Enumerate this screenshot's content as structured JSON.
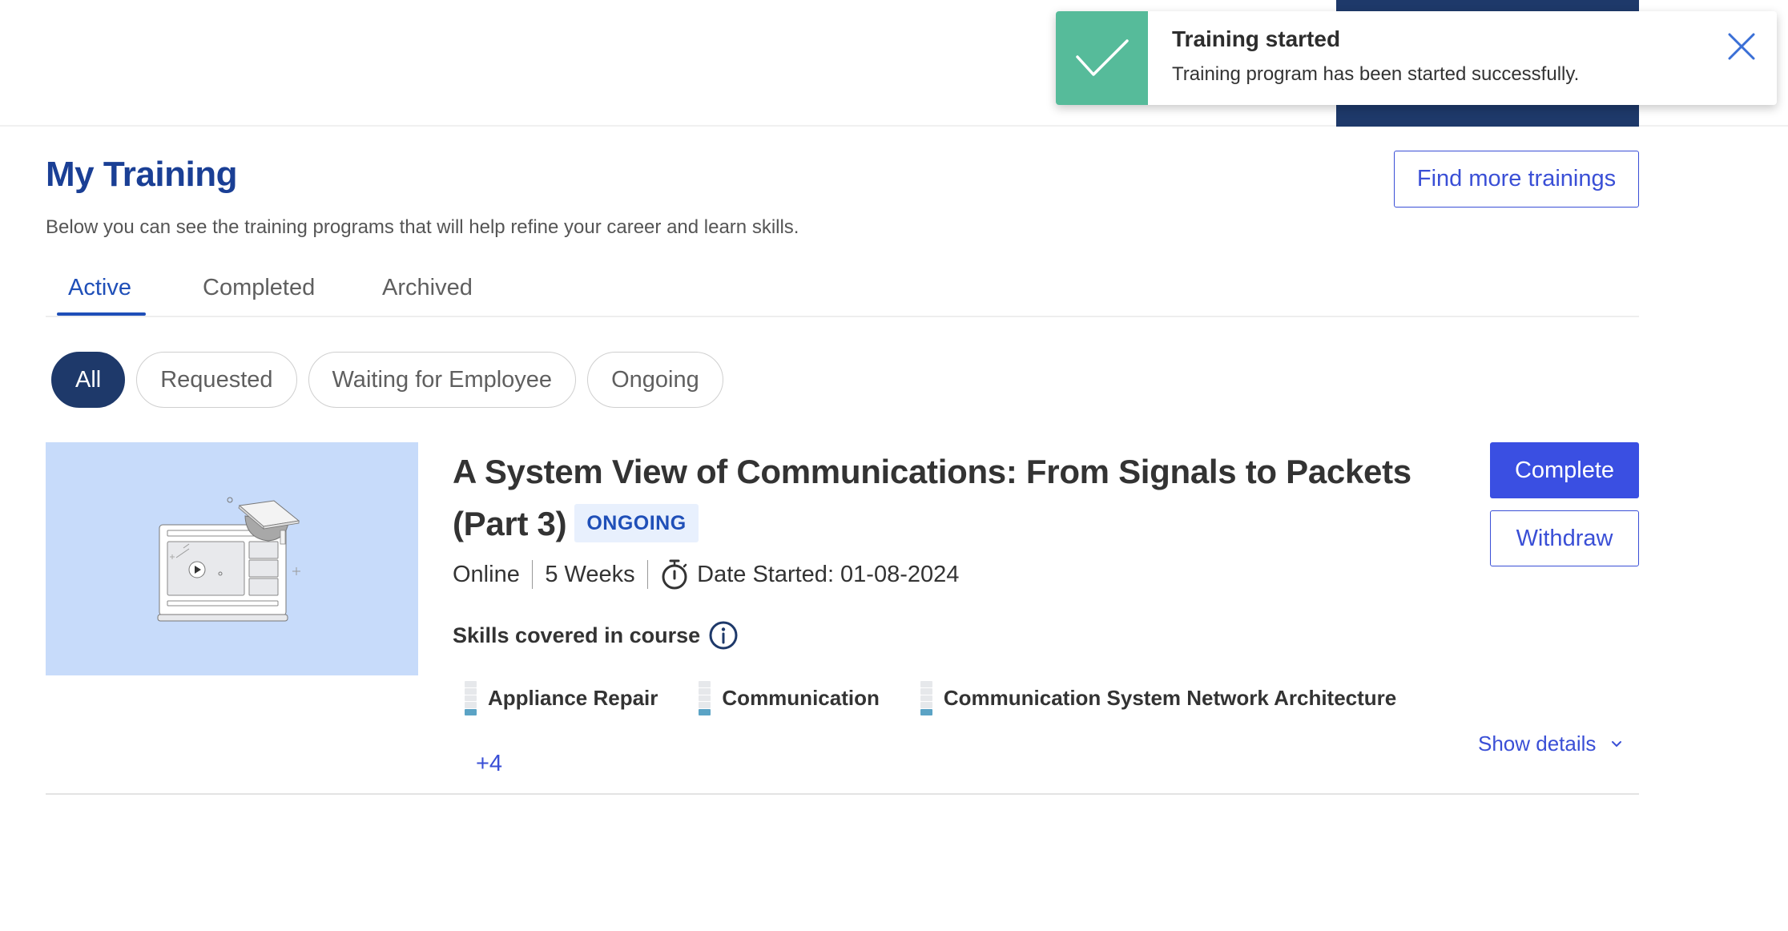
{
  "toast": {
    "title": "Training started",
    "message": "Training program has been started successfully.",
    "icon": "check-icon",
    "close_icon": "close-icon",
    "accent_color": "#56bb9a"
  },
  "page": {
    "title": "My Training",
    "description": "Below you can see the training programs that will help refine your career and learn skills.",
    "find_more_label": "Find more trainings"
  },
  "tabs": [
    {
      "label": "Active",
      "active": true
    },
    {
      "label": "Completed",
      "active": false
    },
    {
      "label": "Archived",
      "active": false
    }
  ],
  "filters": [
    {
      "label": "All",
      "active": true
    },
    {
      "label": "Requested",
      "active": false
    },
    {
      "label": "Waiting for Employee",
      "active": false
    },
    {
      "label": "Ongoing",
      "active": false
    }
  ],
  "course": {
    "title": "A System View of Communications: From Signals to Packets (Part 3)",
    "status": "ONGOING",
    "delivery": "Online",
    "duration": "5 Weeks",
    "date_started": "Date Started: 01-08-2024",
    "skills_heading": "Skills covered in course",
    "skills": [
      {
        "name": "Appliance Repair",
        "level": 1,
        "max_level": 5
      },
      {
        "name": "Communication",
        "level": 1,
        "max_level": 5
      },
      {
        "name": "Communication System Network Architecture",
        "level": 1,
        "max_level": 5
      }
    ],
    "more_skills": "+4",
    "complete_label": "Complete",
    "withdraw_label": "Withdraw",
    "show_details_label": "Show details"
  },
  "colors": {
    "brand_navy": "#1e396a",
    "primary_blue": "#3a4fe2",
    "title_blue": "#1a3f95",
    "thumbnail_bg": "#c7dbfa",
    "skill_fill": "#5ba3c5"
  }
}
